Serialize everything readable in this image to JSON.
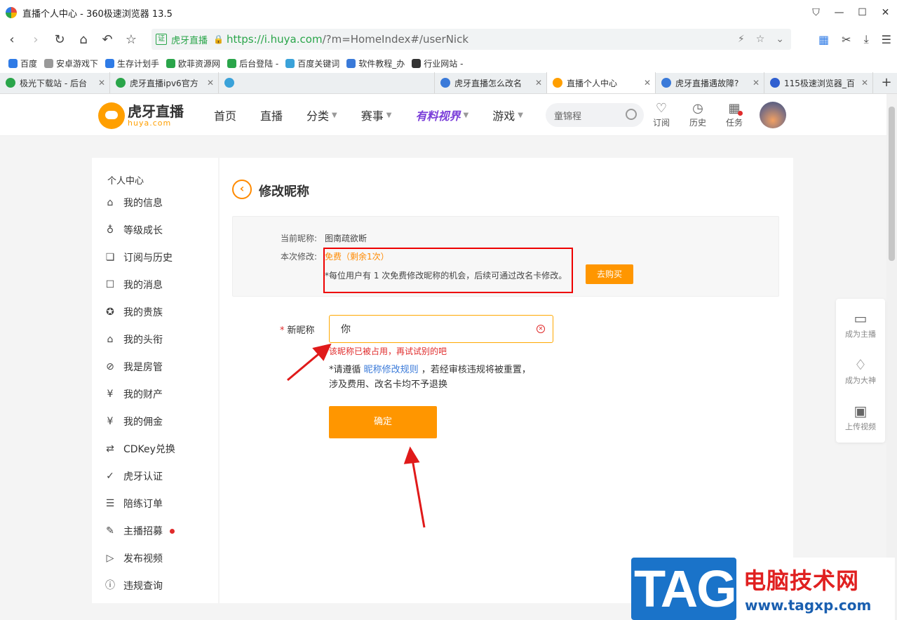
{
  "window": {
    "title": "直播个人中心 - 360极速浏览器 13.5",
    "controls": [
      "⛉",
      "—",
      "☐",
      "✕"
    ]
  },
  "address_bar": {
    "site_name": "虎牙直播",
    "url_host": "https://i.huya.com",
    "url_path": "/?m=HomeIndex#/userNick"
  },
  "bookmarks": [
    {
      "label": "百度",
      "color": "#2f7be6"
    },
    {
      "label": "安卓游戏下",
      "color": "#999999"
    },
    {
      "label": "生存计划手",
      "color": "#2f7be6"
    },
    {
      "label": "欧菲资源网",
      "color": "#2aa54a"
    },
    {
      "label": "后台登陆 -",
      "color": "#2aa54a"
    },
    {
      "label": "百度关键词",
      "color": "#3aa2d9"
    },
    {
      "label": "软件教程_办",
      "color": "#3a7ad9"
    },
    {
      "label": "行业网站 -",
      "color": "#333333"
    }
  ],
  "tabs": [
    {
      "label": "极光下载站 - 后台",
      "color": "#2aa54a",
      "width": 157,
      "active": false,
      "blurred": false
    },
    {
      "label": "虎牙直播ipv6官方",
      "color": "#2aa54a",
      "width": 155,
      "active": false,
      "blurred": false
    },
    {
      "label": "",
      "color": "#3aa2d9",
      "width": 308,
      "active": false,
      "blurred": true
    },
    {
      "label": "虎牙直播怎么改名",
      "color": "#3a7ad9",
      "width": 160,
      "active": false,
      "blurred": false
    },
    {
      "label": "直播个人中心",
      "color": "#ff9f00",
      "width": 155,
      "active": true,
      "blurred": false
    },
    {
      "label": "虎牙直播遇故障?",
      "color": "#3a7ad9",
      "width": 155,
      "active": false,
      "blurred": false
    },
    {
      "label": "115极速浏览器_百",
      "color": "#2f5fd0",
      "width": 155,
      "active": false,
      "blurred": false
    }
  ],
  "site": {
    "logo_cn": "虎牙直播",
    "logo_en": "huya.com",
    "nav": [
      {
        "label": "首页",
        "caret": false
      },
      {
        "label": "直播",
        "caret": false
      },
      {
        "label": "分类",
        "caret": true
      },
      {
        "label": "赛事",
        "caret": true
      },
      {
        "label": "有料视界",
        "caret": true
      },
      {
        "label": "游戏",
        "caret": true
      }
    ],
    "search_placeholder": "童锦程",
    "header_icons": [
      {
        "label": "订阅",
        "glyph": "♡"
      },
      {
        "label": "历史",
        "glyph": "◷"
      },
      {
        "label": "任务",
        "glyph": "▦"
      }
    ]
  },
  "sidebar": {
    "heading": "个人中心",
    "items": [
      {
        "label": "我的信息",
        "icon": "⌂"
      },
      {
        "label": "等级成长",
        "icon": "♁"
      },
      {
        "label": "订阅与历史",
        "icon": "❏"
      },
      {
        "label": "我的消息",
        "icon": "☐"
      },
      {
        "label": "我的贵族",
        "icon": "✪"
      },
      {
        "label": "我的头衔",
        "icon": "⌂"
      },
      {
        "label": "我是房管",
        "icon": "⊘"
      },
      {
        "label": "我的财产",
        "icon": "¥"
      },
      {
        "label": "我的佣金",
        "icon": "¥"
      },
      {
        "label": "CDKey兑换",
        "icon": "⇄"
      },
      {
        "label": "虎牙认证",
        "icon": "✓"
      },
      {
        "label": "陪练订单",
        "icon": "☰"
      },
      {
        "label": "主播招募",
        "icon": "✎",
        "dot": true
      },
      {
        "label": "发布视频",
        "icon": "▷"
      },
      {
        "label": "违规查询",
        "icon": "ⓘ"
      }
    ]
  },
  "main": {
    "title": "修改昵称",
    "current_label": "当前昵称:",
    "current_value": "图南疏欲断",
    "change_label": "本次修改:",
    "free_text": "免费（剩余1次）",
    "note": "*每位用户有 1 次免费修改昵称的机会，后续可通过改名卡修改。",
    "buy_label": "去购买",
    "field_label": "新昵称",
    "input_value": "你",
    "error": "该昵称已被占用，再试试别的吧",
    "rules_prefix": "*请遵循",
    "rules_link": "昵称修改规则",
    "rules_suffix": "，若经审核违规将被重置，",
    "rules_line2": "涉及费用、改名卡均不予退换",
    "confirm_label": "确定"
  },
  "float_bar": [
    {
      "label": "成为主播",
      "glyph": "▭"
    },
    {
      "label": "成为大神",
      "glyph": "♢"
    },
    {
      "label": "上传视频",
      "glyph": "▣"
    }
  ],
  "watermark": {
    "tag": "TAG",
    "cn": "电脑技术网",
    "url": "www.tagxp.com"
  }
}
